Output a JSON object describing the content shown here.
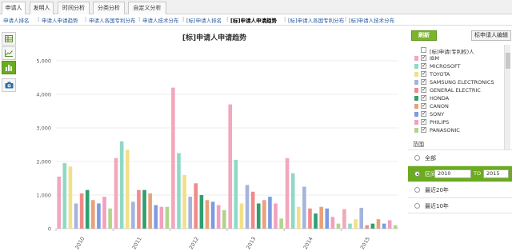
{
  "top_tabs": [
    {
      "label": "申请人",
      "active": true
    },
    {
      "label": "发明人",
      "active": false
    },
    {
      "label": "时间分析",
      "active": false
    },
    {
      "label": "分类分析",
      "active": false
    },
    {
      "label": "自定义分析",
      "active": false
    }
  ],
  "sub_tabs": [
    {
      "label": "申请人排名",
      "active": false
    },
    {
      "label": "申请人申请趋势",
      "active": false
    },
    {
      "label": "申请人各国专利分布",
      "active": false
    },
    {
      "label": "申请人技术分布",
      "active": false
    },
    {
      "label": "[标]申请人排名",
      "active": false
    },
    {
      "label": "[标]申请人申请趋势",
      "active": true
    },
    {
      "label": "[标]申请人各国专利分布",
      "active": false
    },
    {
      "label": "[标]申请人技术分布",
      "active": false
    }
  ],
  "sidebar_tools": [
    {
      "icon": "table-icon",
      "active": false
    },
    {
      "icon": "line-chart-icon",
      "active": false
    },
    {
      "icon": "bar-chart-icon",
      "active": true
    },
    {
      "icon": "camera-icon",
      "active": false
    }
  ],
  "chart_data": {
    "type": "bar",
    "title": "[标]申请人申请趋势",
    "categories": [
      "2010",
      "2011",
      "2012",
      "2013",
      "2014",
      "2015"
    ],
    "ylim": [
      0,
      5000
    ],
    "yticks": [
      "0",
      "1,000",
      "2,000",
      "3,000",
      "4,000",
      "5,000"
    ],
    "grid": true,
    "series": [
      {
        "name": "IBM",
        "color": "#f2a7bb",
        "values": [
          1550,
          2100,
          4200,
          3700,
          2100,
          580
        ]
      },
      {
        "name": "MICROSOFT",
        "color": "#8fd9c5",
        "values": [
          1950,
          2600,
          2250,
          2050,
          1650,
          150
        ]
      },
      {
        "name": "TOYOTA",
        "color": "#f0e08a",
        "values": [
          1850,
          2350,
          1600,
          750,
          650,
          280
        ]
      },
      {
        "name": "SAMSUNG ELECTRONICS",
        "color": "#a5b4dd",
        "values": [
          750,
          800,
          950,
          1300,
          1250,
          620
        ]
      },
      {
        "name": "GENERAL ELECTRIC",
        "color": "#f08a8a",
        "values": [
          1050,
          1150,
          1350,
          1100,
          600,
          100
        ]
      },
      {
        "name": "HONDA",
        "color": "#2f9f6f",
        "values": [
          1150,
          1150,
          1000,
          750,
          450,
          150
        ]
      },
      {
        "name": "CANON",
        "color": "#e8a17a",
        "values": [
          850,
          1050,
          850,
          850,
          650,
          280
        ]
      },
      {
        "name": "SONY",
        "color": "#7e9be0",
        "values": [
          750,
          700,
          800,
          950,
          600,
          150
        ]
      },
      {
        "name": "PHILIPS",
        "color": "#f3a0c0",
        "values": [
          950,
          650,
          700,
          750,
          350,
          250
        ]
      },
      {
        "name": "PANASONIC",
        "color": "#b1d48a",
        "values": [
          600,
          650,
          550,
          300,
          150,
          100
        ]
      }
    ]
  },
  "panel": {
    "refresh_label": "刷新",
    "edit_label": "标申请人编辑",
    "list_header": "[标]申请(专利权)人",
    "items": [
      {
        "label": "IBM",
        "color": "#f2a7bb"
      },
      {
        "label": "MICROSOFT",
        "color": "#8fd9c5"
      },
      {
        "label": "TOYOTA",
        "color": "#f0e08a"
      },
      {
        "label": "SAMSUNG ELECTRONICS",
        "color": "#a5b4dd"
      },
      {
        "label": "GENERAL ELECTRIC",
        "color": "#f08a8a"
      },
      {
        "label": "HONDA",
        "color": "#2f9f6f"
      },
      {
        "label": "CANON",
        "color": "#e8a17a"
      },
      {
        "label": "SONY",
        "color": "#7e9be0"
      },
      {
        "label": "PHILIPS",
        "color": "#f3a0c0"
      },
      {
        "label": "PANASONIC",
        "color": "#b1d48a"
      }
    ],
    "range_title": "范围",
    "options": [
      {
        "label": "全部",
        "active": false
      },
      {
        "label": "区间",
        "active": true,
        "from": "2010",
        "to_label": "TO",
        "to": "2015"
      },
      {
        "label": "最近20年",
        "active": false
      },
      {
        "label": "最近10年",
        "active": false
      }
    ]
  }
}
